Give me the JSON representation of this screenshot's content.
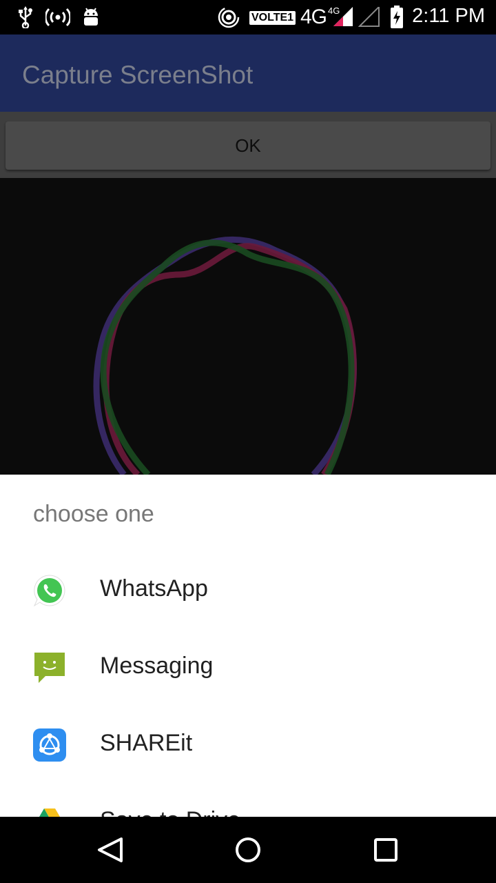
{
  "status_bar": {
    "time": "2:11 PM",
    "volte": "VOLTE1",
    "network": "4G",
    "network_sup": "4G",
    "icons": [
      "usb-icon",
      "hotspot-icon",
      "android-debug-icon",
      "wifi-hotspot-icon",
      "signal-icon",
      "signal-empty-icon",
      "battery-charging-icon"
    ]
  },
  "app_bar": {
    "title": "Capture ScreenShot"
  },
  "ok_button": {
    "label": "OK"
  },
  "share_sheet": {
    "title": "choose one",
    "options": [
      {
        "label": "WhatsApp",
        "icon": "whatsapp-icon"
      },
      {
        "label": "Messaging",
        "icon": "messaging-icon"
      },
      {
        "label": "SHAREit",
        "icon": "shareit-icon"
      },
      {
        "label": "Save to Drive",
        "icon": "drive-icon"
      }
    ]
  },
  "nav_bar": {
    "icons": [
      "back-icon",
      "home-icon",
      "recents-icon"
    ]
  },
  "colors": {
    "app_bar": "#1d2a5c",
    "whatsapp": "#43c553",
    "messaging": "#8cb12b",
    "shareit": "#2e8ef0"
  }
}
